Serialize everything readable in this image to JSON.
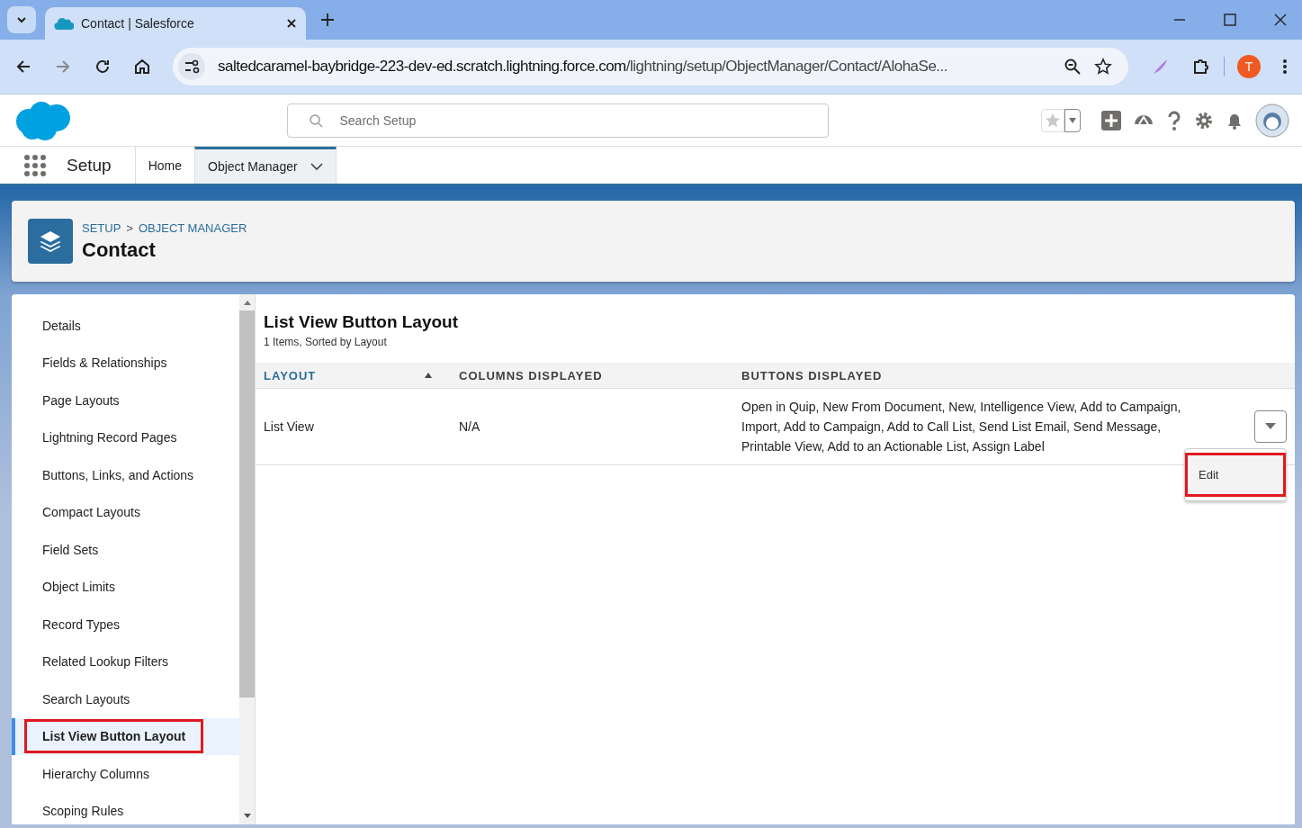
{
  "browser": {
    "tab_title": "Contact | Salesforce",
    "url_host": "saltedcaramel-baybridge-223-dev-ed.scratch.lightning.force.com",
    "url_path": "/lightning/setup/ObjectManager/Contact/AlohaSe...",
    "profile_initial": "T"
  },
  "header": {
    "search": {
      "placeholder": "Search Setup"
    }
  },
  "nav": {
    "app_name": "Setup",
    "tabs": [
      {
        "label": "Home",
        "selected": false,
        "has_menu": false
      },
      {
        "label": "Object Manager",
        "selected": true,
        "has_menu": true
      }
    ]
  },
  "page_header": {
    "breadcrumbs": [
      "SETUP",
      "OBJECT MANAGER"
    ],
    "separator": ">",
    "title": "Contact"
  },
  "sidebar": {
    "items": [
      {
        "label": "Details",
        "selected": false,
        "highlighted": false
      },
      {
        "label": "Fields & Relationships",
        "selected": false,
        "highlighted": false
      },
      {
        "label": "Page Layouts",
        "selected": false,
        "highlighted": false
      },
      {
        "label": "Lightning Record Pages",
        "selected": false,
        "highlighted": false
      },
      {
        "label": "Buttons, Links, and Actions",
        "selected": false,
        "highlighted": false
      },
      {
        "label": "Compact Layouts",
        "selected": false,
        "highlighted": false
      },
      {
        "label": "Field Sets",
        "selected": false,
        "highlighted": false
      },
      {
        "label": "Object Limits",
        "selected": false,
        "highlighted": false
      },
      {
        "label": "Record Types",
        "selected": false,
        "highlighted": false
      },
      {
        "label": "Related Lookup Filters",
        "selected": false,
        "highlighted": false
      },
      {
        "label": "Search Layouts",
        "selected": false,
        "highlighted": false
      },
      {
        "label": "List View Button Layout",
        "selected": true,
        "highlighted": true
      },
      {
        "label": "Hierarchy Columns",
        "selected": false,
        "highlighted": false
      },
      {
        "label": "Scoping Rules",
        "selected": false,
        "highlighted": false
      }
    ]
  },
  "content": {
    "title": "List View Button Layout",
    "subtitle": "1 Items, Sorted by Layout",
    "table": {
      "columns": [
        {
          "label": "LAYOUT",
          "sorted": true
        },
        {
          "label": "COLUMNS DISPLAYED",
          "sorted": false
        },
        {
          "label": "BUTTONS DISPLAYED",
          "sorted": false
        }
      ],
      "rows": [
        {
          "cells": [
            "List View",
            "N/A",
            "Open in Quip, New From Document, New, Intelligence View, Add to Campaign, Import, Add to Campaign, Add to Call List, Send List Email, Send Message, Printable View, Add to an Actionable List, Assign Label"
          ]
        }
      ]
    },
    "row_menu": {
      "open": true,
      "items": [
        {
          "label": "Edit",
          "highlighted": true
        }
      ]
    }
  }
}
